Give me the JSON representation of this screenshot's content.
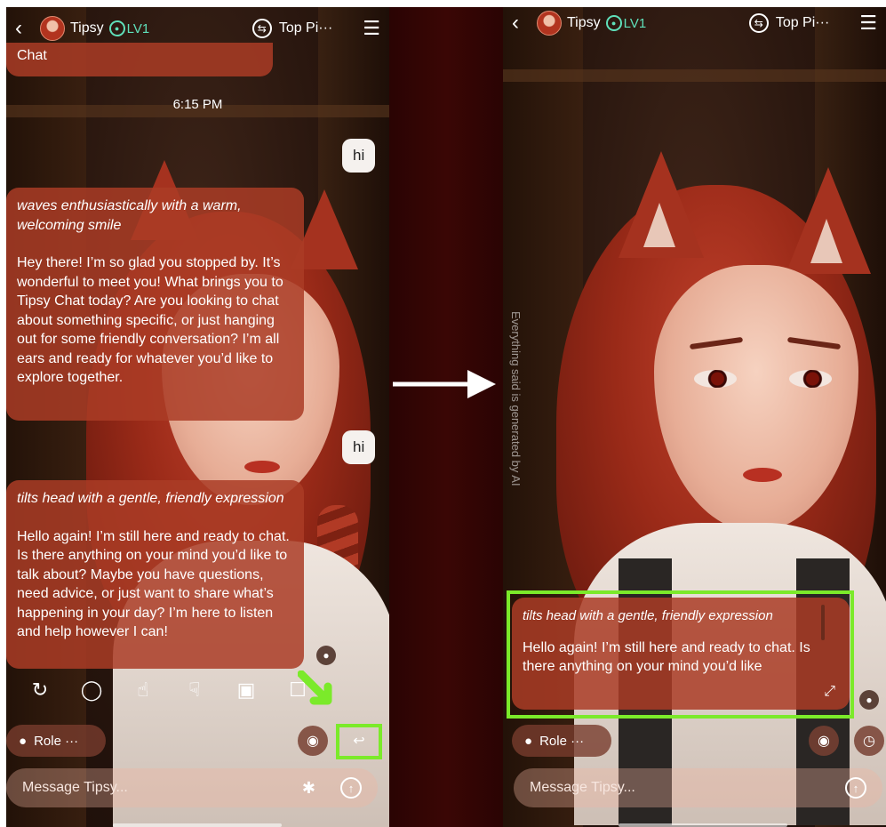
{
  "header": {
    "back_icon": "chevron-left-icon",
    "bot_name": "Tipsy",
    "level": "LV1",
    "top_pick": "Top Pi···",
    "menu_icon": "hamburger-menu-icon"
  },
  "left_chat": {
    "partial_previous": "Chat",
    "timestamp": "6:15 PM",
    "user_message_1": "hi",
    "bot_message_1": {
      "action": "waves enthusiastically with a warm, welcoming smile",
      "text": "Hey there! I’m so glad you stopped by. It’s wonderful to meet you! What brings you to Tipsy Chat today? Are you looking to chat about something specific, or just hanging out for some friendly conversation? I’m all ears and ready for whatever you’d like to explore together."
    },
    "user_message_2": "hi",
    "bot_message_2": {
      "action": "tilts head with a gentle, friendly expression",
      "text": "Hello again! I’m still here and ready to chat. Is there anything on your mind you’d like to talk about? Maybe you have questions, need advice, or just want to share what’s happening in your day? I’m here to listen and help however I can!"
    }
  },
  "actions": [
    "regenerate-icon",
    "rewrite-icon",
    "thumbs-up-icon",
    "thumbs-down-icon",
    "add-image-icon",
    "share-icon"
  ],
  "controls": {
    "role_label": "Role ···",
    "message_placeholder": "Message Tipsy..."
  },
  "right_chat": {
    "disclaimer": "Everything said is generated by AI",
    "bot_message": {
      "action": "tilts head with a gentle, friendly expression",
      "text": "Hello again! I’m still here and ready to chat. Is there anything on your mind you’d like"
    }
  },
  "colors": {
    "bubble": "#aa3c26",
    "highlight": "#7bea2a",
    "level": "#5fe0ba",
    "divider": "#2a0403"
  }
}
